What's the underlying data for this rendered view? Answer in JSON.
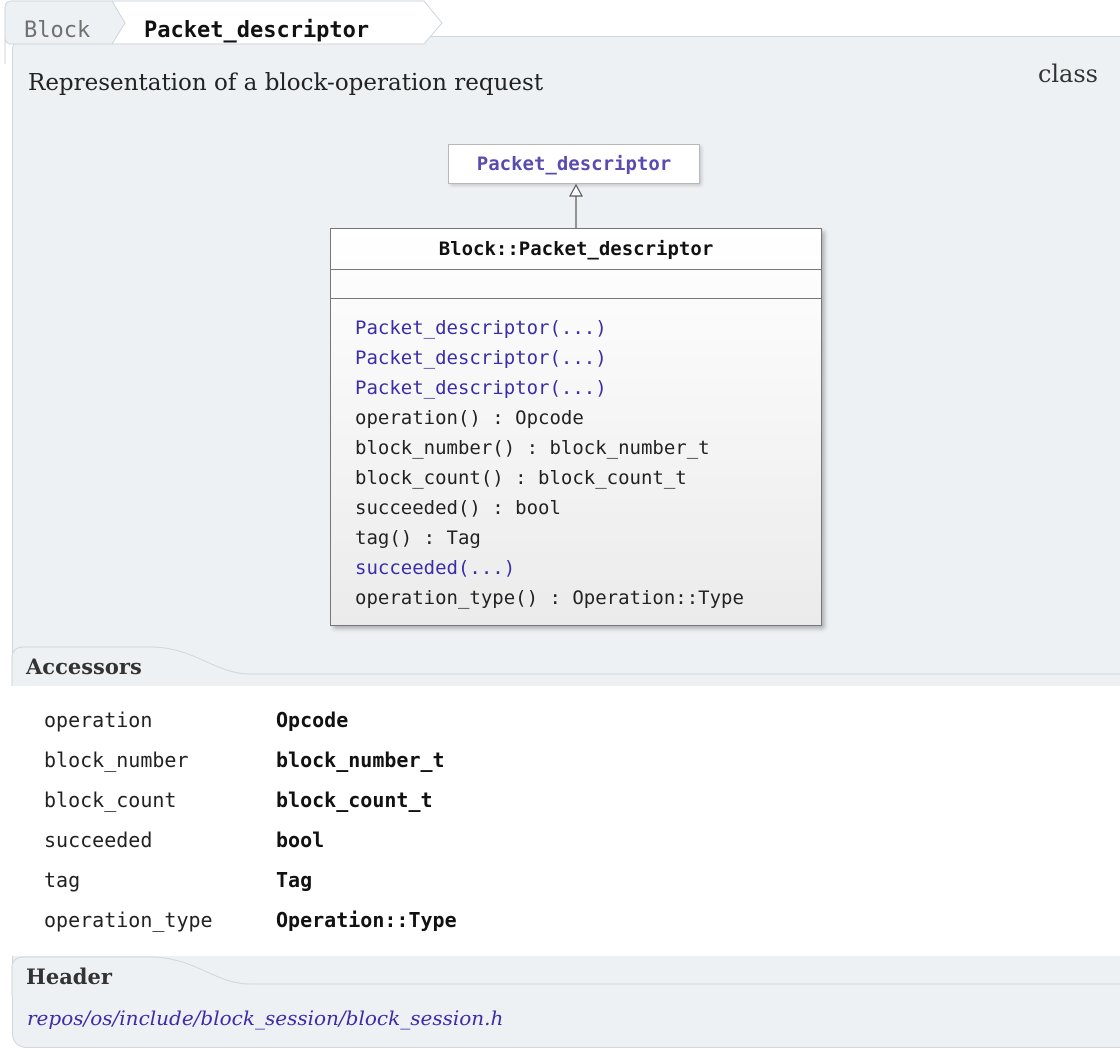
{
  "breadcrumb": {
    "parent": "Block",
    "current": "Packet_descriptor"
  },
  "description": "Representation of a block-operation request",
  "kind": "class",
  "diagram": {
    "base_class": "Packet_descriptor",
    "class_name": "Block::Packet_descriptor",
    "operations": [
      {
        "text": "Packet_descriptor(...)",
        "link": true
      },
      {
        "text": "Packet_descriptor(...)",
        "link": true
      },
      {
        "text": "Packet_descriptor(...)",
        "link": true
      },
      {
        "text": "operation() : Opcode",
        "link": false
      },
      {
        "text": "block_number() : block_number_t",
        "link": false
      },
      {
        "text": "block_count() : block_count_t",
        "link": false
      },
      {
        "text": "succeeded() : bool",
        "link": false
      },
      {
        "text": "tag() : Tag",
        "link": false
      },
      {
        "text": "succeeded(...)",
        "link": true
      },
      {
        "text": "operation_type() : Operation::Type",
        "link": false
      }
    ]
  },
  "accessors": {
    "title": "Accessors",
    "rows": [
      {
        "name": "operation",
        "type": "Opcode"
      },
      {
        "name": "block_number",
        "type": "block_number_t"
      },
      {
        "name": "block_count",
        "type": "block_count_t"
      },
      {
        "name": "succeeded",
        "type": "bool"
      },
      {
        "name": "tag",
        "type": "Tag"
      },
      {
        "name": "operation_type",
        "type": "Operation::Type"
      }
    ]
  },
  "header": {
    "title": "Header",
    "path": "repos/os/include/block_session/block_session.h"
  },
  "colors": {
    "panel": "#eef1f4",
    "link": "#3b2ca8",
    "base_link": "#5a4bb0"
  }
}
